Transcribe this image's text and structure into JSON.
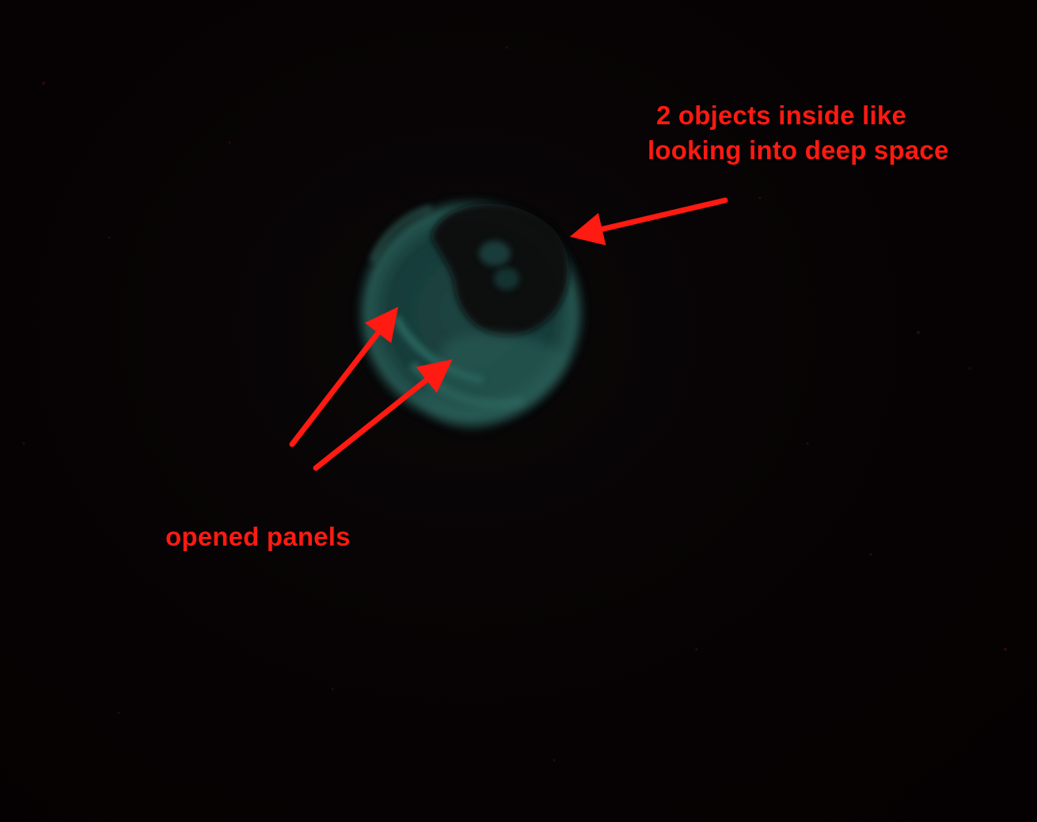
{
  "annotations": {
    "objects_inside_line1": "2 objects inside like",
    "objects_inside_line2": "looking into deep space",
    "opened_panels": "opened panels"
  },
  "colors": {
    "annotation_red": "#ff1a12",
    "background": "#060203",
    "object_teal": "#2f6f66"
  }
}
